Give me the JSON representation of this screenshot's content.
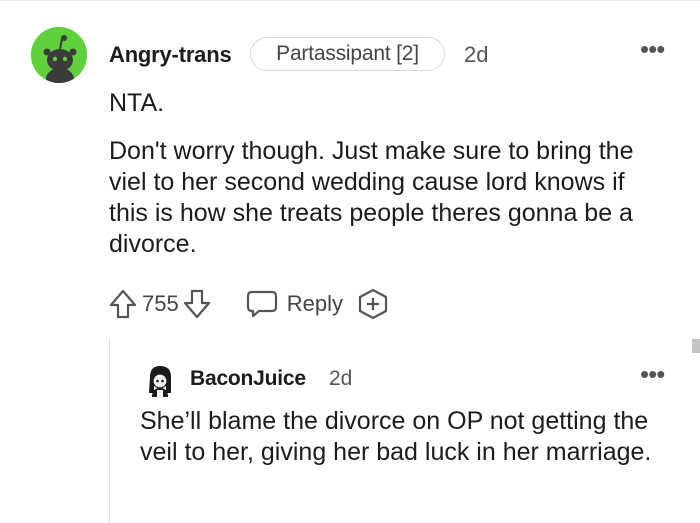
{
  "comment": {
    "username": "Angry-trans",
    "flair": "Partassipant [2]",
    "time": "2d",
    "more_label": "•••",
    "body": [
      "NTA.",
      "Don't worry though. Just make sure to bring the viel to her second wedding cause lord knows if this is how she treats people theres gonna be a divorce."
    ],
    "votes": "755",
    "reply_label": "Reply",
    "icons": {
      "upvote": "upvote-arrow-icon",
      "downvote": "downvote-arrow-icon",
      "reply": "speech-bubble-icon",
      "award": "award-plus-icon",
      "avatar": "snoo-avatar-icon"
    },
    "accent": "#5fd13b"
  },
  "reply": {
    "username": "BaconJuice",
    "time": "2d",
    "more_label": "•••",
    "body": "She’ll blame the divorce on OP not getting the veil to her, giving her bad luck in her marriage."
  }
}
